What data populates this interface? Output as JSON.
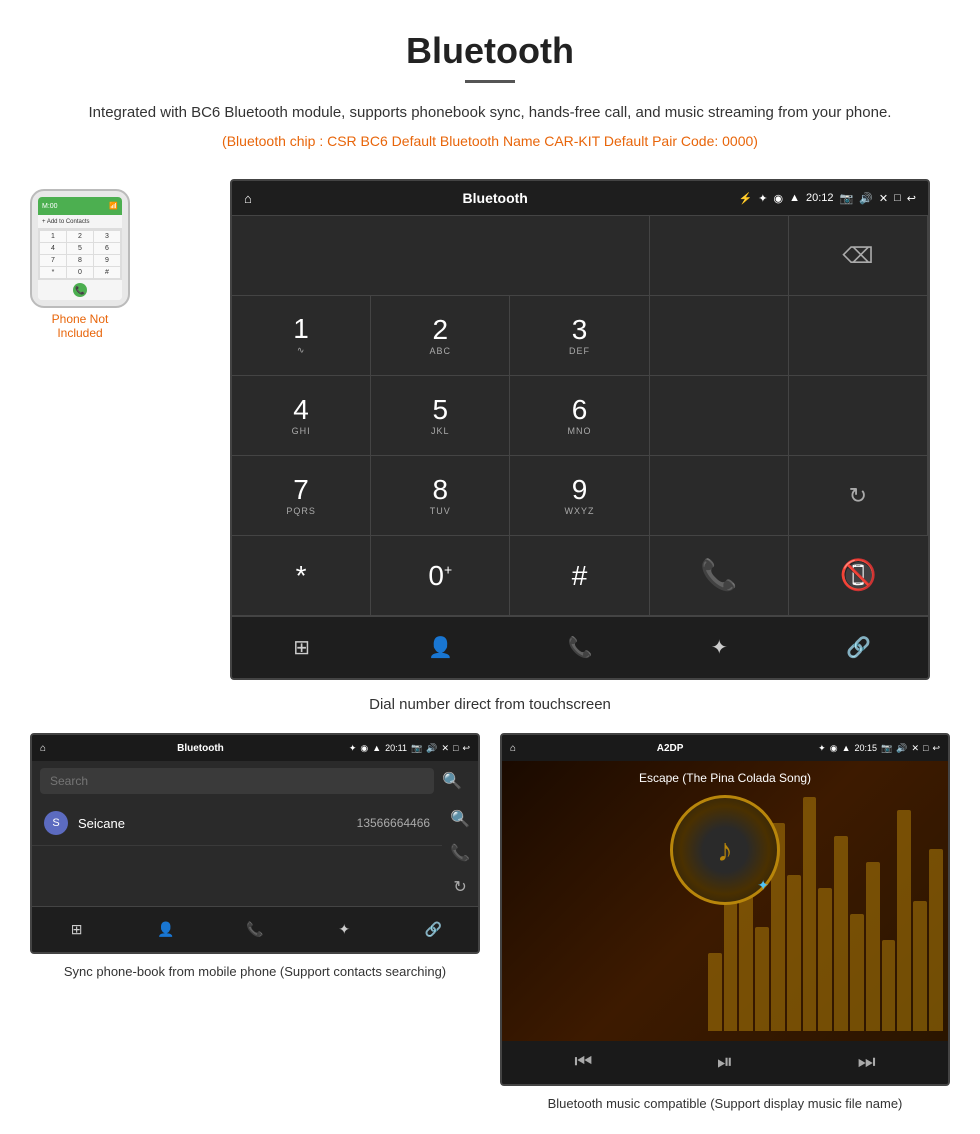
{
  "header": {
    "title": "Bluetooth",
    "description": "Integrated with BC6 Bluetooth module, supports phonebook sync, hands-free call, and music streaming from your phone.",
    "specs": "(Bluetooth chip : CSR BC6   Default Bluetooth Name CAR-KIT    Default Pair Code: 0000)"
  },
  "main_screen": {
    "title": "Bluetooth",
    "time": "20:12",
    "keys": [
      {
        "num": "1",
        "sub": ""
      },
      {
        "num": "2",
        "sub": "ABC"
      },
      {
        "num": "3",
        "sub": "DEF"
      },
      {
        "num": "4",
        "sub": "GHI"
      },
      {
        "num": "5",
        "sub": "JKL"
      },
      {
        "num": "6",
        "sub": "MNO"
      },
      {
        "num": "7",
        "sub": "PQRS"
      },
      {
        "num": "8",
        "sub": "TUV"
      },
      {
        "num": "9",
        "sub": "WXYZ"
      },
      {
        "num": "*",
        "sub": ""
      },
      {
        "num": "0",
        "sub": "+"
      },
      {
        "num": "#",
        "sub": ""
      }
    ]
  },
  "main_caption": "Dial number direct from touchscreen",
  "phone_not_included": "Phone Not Included",
  "contacts_screen": {
    "title": "Bluetooth",
    "time": "20:11",
    "search_placeholder": "Search",
    "contact": {
      "letter": "S",
      "name": "Seicane",
      "number": "13566664466"
    }
  },
  "music_screen": {
    "title": "A2DP",
    "time": "20:15",
    "song_title": "Escape (The Pina Colada Song)"
  },
  "bottom_captions": {
    "left": "Sync phone-book from mobile phone\n(Support contacts searching)",
    "right": "Bluetooth music compatible\n(Support display music file name)"
  }
}
